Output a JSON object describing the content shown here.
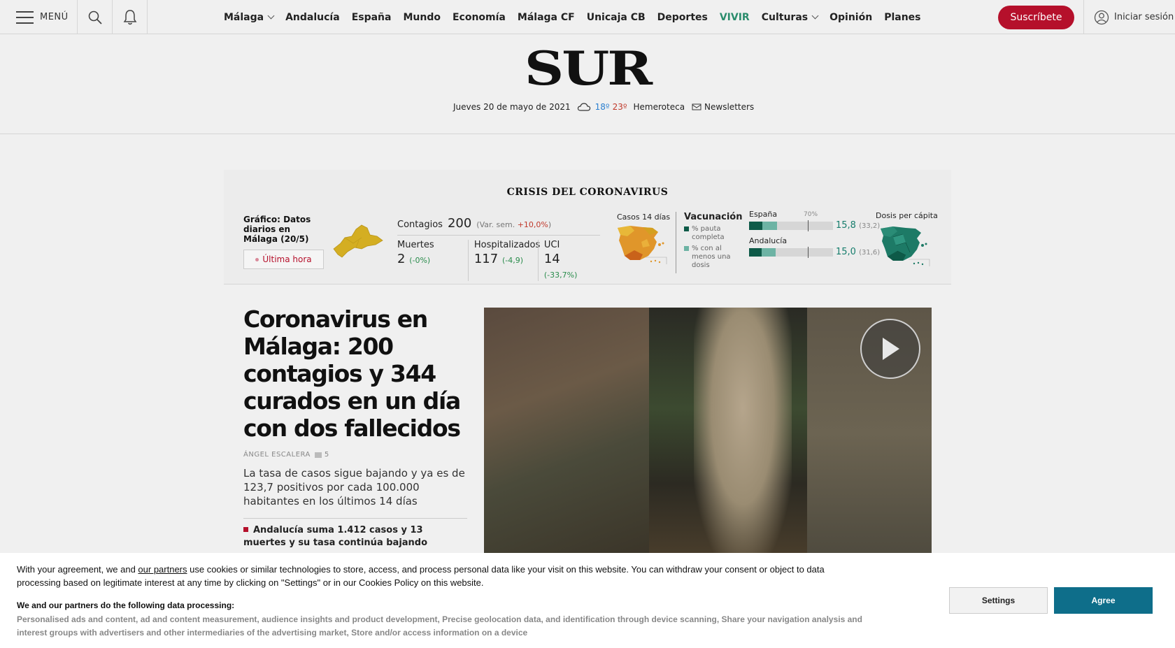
{
  "topbar": {
    "menu_label": "MENÚ",
    "nav": [
      {
        "label": "Málaga",
        "dropdown": true
      },
      {
        "label": "Andalucía"
      },
      {
        "label": "España"
      },
      {
        "label": "Mundo"
      },
      {
        "label": "Economía"
      },
      {
        "label": "Málaga CF"
      },
      {
        "label": "Unicaja CB"
      },
      {
        "label": "Deportes"
      },
      {
        "label": "VIVIR",
        "accent": true
      },
      {
        "label": "Culturas",
        "dropdown": true
      },
      {
        "label": "Opinión"
      },
      {
        "label": "Planes"
      }
    ],
    "subscribe_label": "Suscríbete",
    "login_label": "Iniciar sesión"
  },
  "masthead": {
    "logo": "SUR",
    "date": "Jueves 20 de mayo de 2021",
    "temp_min": "18º",
    "temp_max": "23º",
    "hemeroteca": "Hemeroteca",
    "newsletters": "Newsletters"
  },
  "covid": {
    "title": "CRISIS DEL CORONAVIRUS",
    "grafico_label": "Gráfico: Datos diarios en Málaga (20/5)",
    "ultima_hora": "Última hora",
    "contagios": {
      "label": "Contagios",
      "value": "200",
      "var_prefix": "(Var. sem.",
      "var_value": "+10,0%",
      "var_suffix": ")"
    },
    "muertes": {
      "label": "Muertes",
      "value": "2",
      "var": "(-0%)"
    },
    "hospitalizados": {
      "label": "Hospitalizados",
      "value": "117",
      "var": "(-4,9)"
    },
    "uci": {
      "label": "UCI",
      "value": "14",
      "var": "(-33,7%)"
    },
    "casos14_label": "Casos 14 días",
    "vacunacion": {
      "title": "Vacunación",
      "legend_full": "% pauta completa",
      "legend_partial": "% con al menos una dosis",
      "color_full": "#0e5a48",
      "color_partial": "#6db3a4",
      "pct_mark": "70%",
      "dosis_label": "Dosis per cápita",
      "rows": [
        {
          "label": "España",
          "value": "15,8",
          "sub": "(33,2)",
          "full": 15.8,
          "partial": 33.2
        },
        {
          "label": "Andalucía",
          "value": "15,0",
          "sub": "(31,6)",
          "full": 15.0,
          "partial": 31.6
        }
      ]
    }
  },
  "story": {
    "headline": "Coronavirus en Málaga: 200 contagios y 344 curados en un día con dos fallecidos",
    "author": "ÁNGEL ESCALERA",
    "comments": "5",
    "summary": "La tasa de casos sigue bajando y ya es de 123,7 positivos por cada 100.000 habitantes en los últimos 14 días",
    "related": "Andalucía suma 1.412 casos y 13 muertes y su tasa continúa bajando"
  },
  "cookie": {
    "text_before": "With your agreement, we and ",
    "partners_link": "our partners",
    "text_after": " use cookies or similar technologies to store, access, and process personal data like your visit on this website. You can withdraw your consent or object to data processing based on legitimate interest at any time by clicking on \"Settings\" or in our Cookies Policy on this website.",
    "heading": "We and our partners do the following data processing:",
    "purposes": "Personalised ads and content, ad and content measurement, audience insights and product development, Precise geolocation data, and identification through device scanning, Share your navigation analysis and interest groups with advertisers and other intermediaries of the advertising market, Store and/or access information on a device",
    "settings_label": "Settings",
    "agree_label": "Agree"
  }
}
